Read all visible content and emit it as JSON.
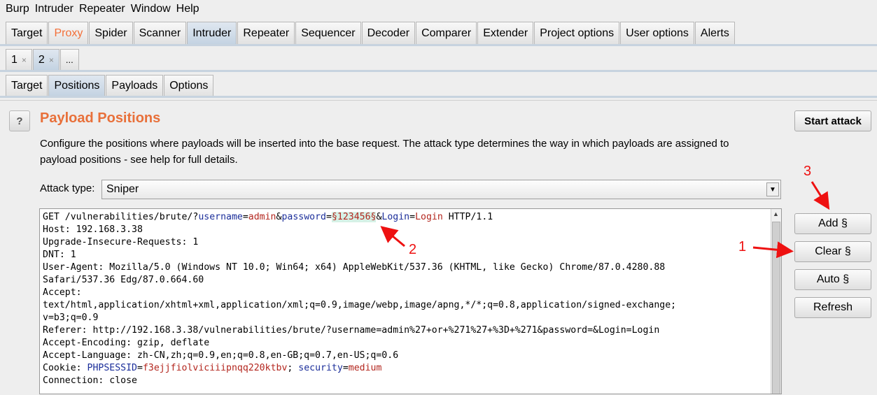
{
  "menu": [
    "Burp",
    "Intruder",
    "Repeater",
    "Window",
    "Help"
  ],
  "main_tabs": [
    "Target",
    "Proxy",
    "Spider",
    "Scanner",
    "Intruder",
    "Repeater",
    "Sequencer",
    "Decoder",
    "Comparer",
    "Extender",
    "Project options",
    "User options",
    "Alerts"
  ],
  "attack_tabs": {
    "t1": "1",
    "t2": "2",
    "more": "...",
    "close": "×"
  },
  "sub_tabs": [
    "Target",
    "Positions",
    "Payloads",
    "Options"
  ],
  "panel": {
    "help": "?",
    "title": "Payload Positions",
    "desc": "Configure the positions where payloads will be inserted into the base request. The attack type determines the way in which payloads are assigned to payload positions - see help for full details.",
    "attack_label": "Attack type:",
    "attack_value": "Sniper",
    "start_attack": "Start attack",
    "add": "Add §",
    "clear": "Clear §",
    "auto": "Auto §",
    "refresh": "Refresh"
  },
  "request": {
    "l1a": "GET /vulnerabilities/brute/?",
    "l1k1": "username",
    "l1e1": "=",
    "l1v1": "admin",
    "l1amp1": "&",
    "l1k2": "password",
    "l1e2": "=",
    "l1marker": "§123456§",
    "l1amp2": "&",
    "l1k3": "Login",
    "l1e3": "=",
    "l1v3": "Login",
    "l1end": " HTTP/1.1",
    "l2": "Host: 192.168.3.38",
    "l3": "Upgrade-Insecure-Requests: 1",
    "l4": "DNT: 1",
    "l5": "User-Agent: Mozilla/5.0 (Windows NT 10.0; Win64; x64) AppleWebKit/537.36 (KHTML, like Gecko) Chrome/87.0.4280.88",
    "l6": "Safari/537.36 Edg/87.0.664.60",
    "l7": "Accept:",
    "l8": "text/html,application/xhtml+xml,application/xml;q=0.9,image/webp,image/apng,*/*;q=0.8,application/signed-exchange;",
    "l9": "v=b3;q=0.9",
    "l10": "Referer: http://192.168.3.38/vulnerabilities/brute/?username=admin%27+or+%271%27+%3D+%271&password=&Login=Login",
    "l11": "Accept-Encoding: gzip, deflate",
    "l12": "Accept-Language: zh-CN,zh;q=0.9,en;q=0.8,en-GB;q=0.7,en-US;q=0.6",
    "l13a": "Cookie: ",
    "l13k1": "PHPSESSID",
    "l13e1": "=",
    "l13v1": "f3ejjfiolviciiipnqq220ktbv",
    "l13sep": "; ",
    "l13k2": "security",
    "l13e2": "=",
    "l13v2": "medium",
    "l14": "Connection: close"
  },
  "annotations": {
    "a1": "1",
    "a2": "2",
    "a3": "3"
  },
  "colors": {
    "accent": "#e8703a",
    "annotation": "#ee1111",
    "marker_bg": "#d6f1e6"
  }
}
